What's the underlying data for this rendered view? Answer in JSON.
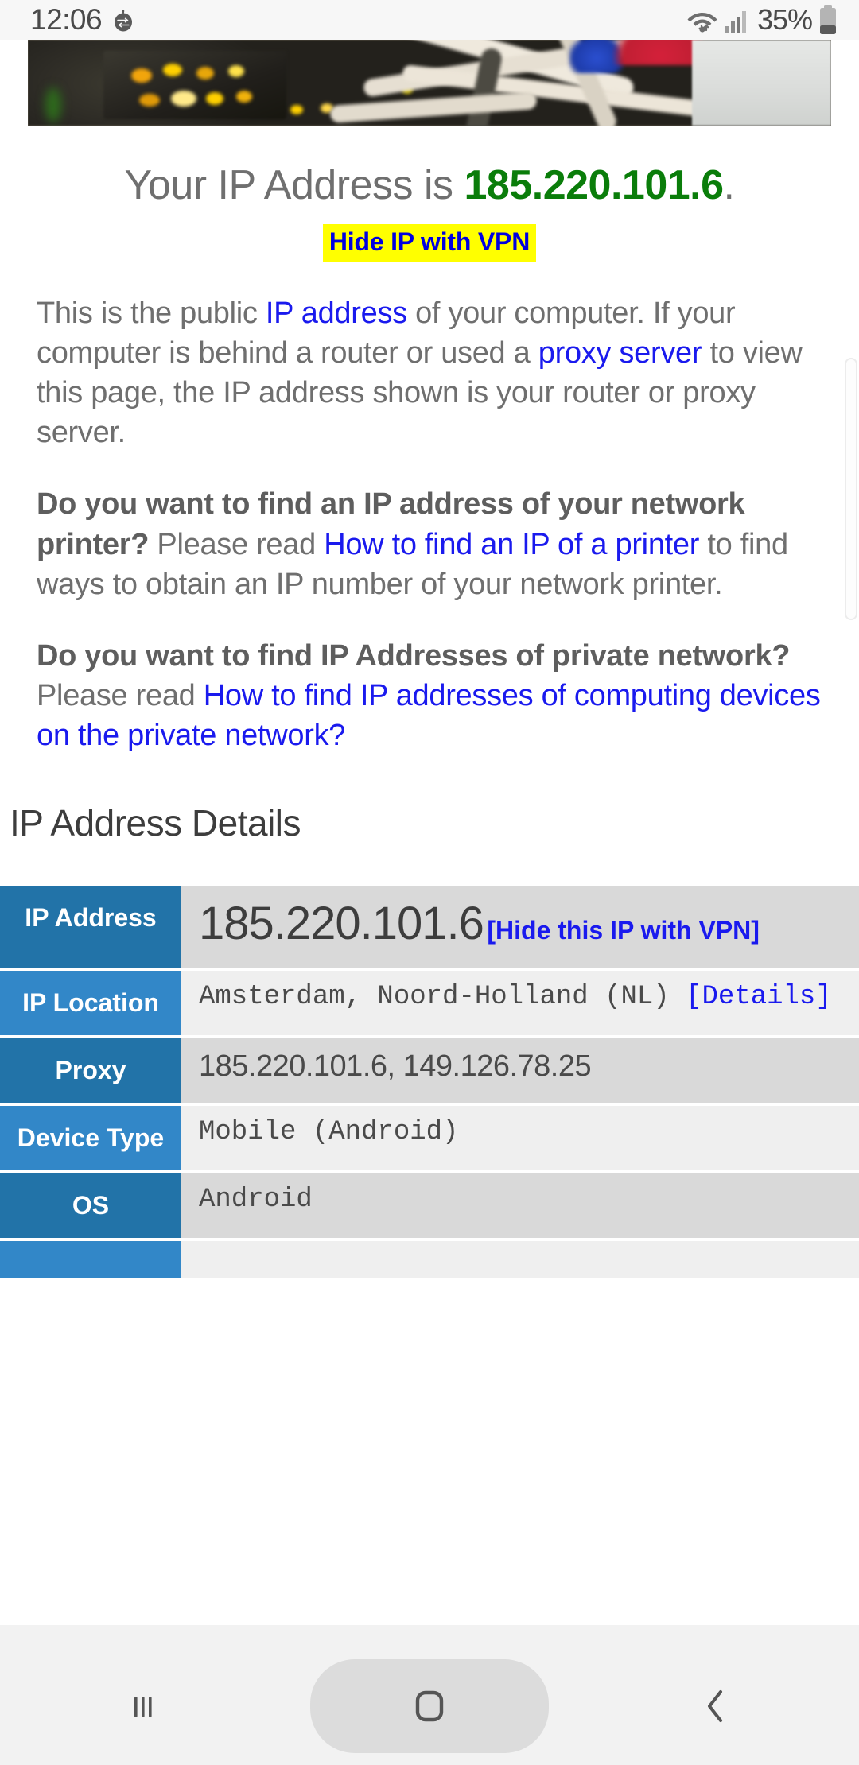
{
  "statusbar": {
    "time": "12:06",
    "sync_icon": "data-transfer-icon",
    "wifi_icon": "wifi-icon",
    "signal_icon": "cellular-signal-icon",
    "battery_percent": "35%",
    "battery_icon": "battery-icon",
    "bg_color": "#f7f7f7",
    "text_color": "#4a4a4a"
  },
  "banner": {
    "alt": "network-switch-photo"
  },
  "header": {
    "prefix": "Your IP Address is ",
    "ip": "185.220.101.6",
    "suffix": ".",
    "ip_color": "#0a7d0a",
    "vpn_link": "Hide IP with VPN",
    "vpn_link_color": "#0000e0",
    "vpn_highlight_color": "#ffff00"
  },
  "paragraphs": {
    "p1": {
      "t1": "This is the public ",
      "l1": "IP address",
      "t2": " of your computer. If your computer is behind a router or used a ",
      "l2": "proxy server",
      "t3": " to view this page, the IP address shown is your router or proxy server."
    },
    "p2": {
      "b1": "Do you want to find an IP address of your network printer?",
      "t1": " Please read ",
      "l1": "How to find an IP of a printer",
      "t2": " to find ways to obtain an IP number of your network printer."
    },
    "p3": {
      "b1": "Do you want to find IP Addresses of private network?",
      "t1": " Please read ",
      "l1": "How to find IP addresses of computing devices on the private network?"
    },
    "link_color": "#1a1aee",
    "text_color": "#6f6f6f"
  },
  "details": {
    "heading": "IP Address Details",
    "rows": [
      {
        "label": "IP Address",
        "value": "185.220.101.6",
        "link": "[Hide this IP with VPN]",
        "style": "bigip"
      },
      {
        "label": "IP Location",
        "value": "Amsterdam, Noord-Holland (NL) ",
        "link": "[Details]",
        "style": "mono"
      },
      {
        "label": "Proxy",
        "value": "185.220.101.6, 149.126.78.25",
        "link": "",
        "style": "plain"
      },
      {
        "label": "Device Type",
        "value": "Mobile (Android)",
        "link": "",
        "style": "mono"
      },
      {
        "label": "OS",
        "value": "Android",
        "link": "",
        "style": "mono"
      }
    ],
    "label_color_dark": "#2273a8",
    "label_color_light": "#3287c8",
    "value_bg_a": "#d9d9d9",
    "value_bg_b": "#efefef"
  },
  "navbar": {
    "recents": "recents-icon",
    "home": "home-icon",
    "back": "back-icon"
  }
}
